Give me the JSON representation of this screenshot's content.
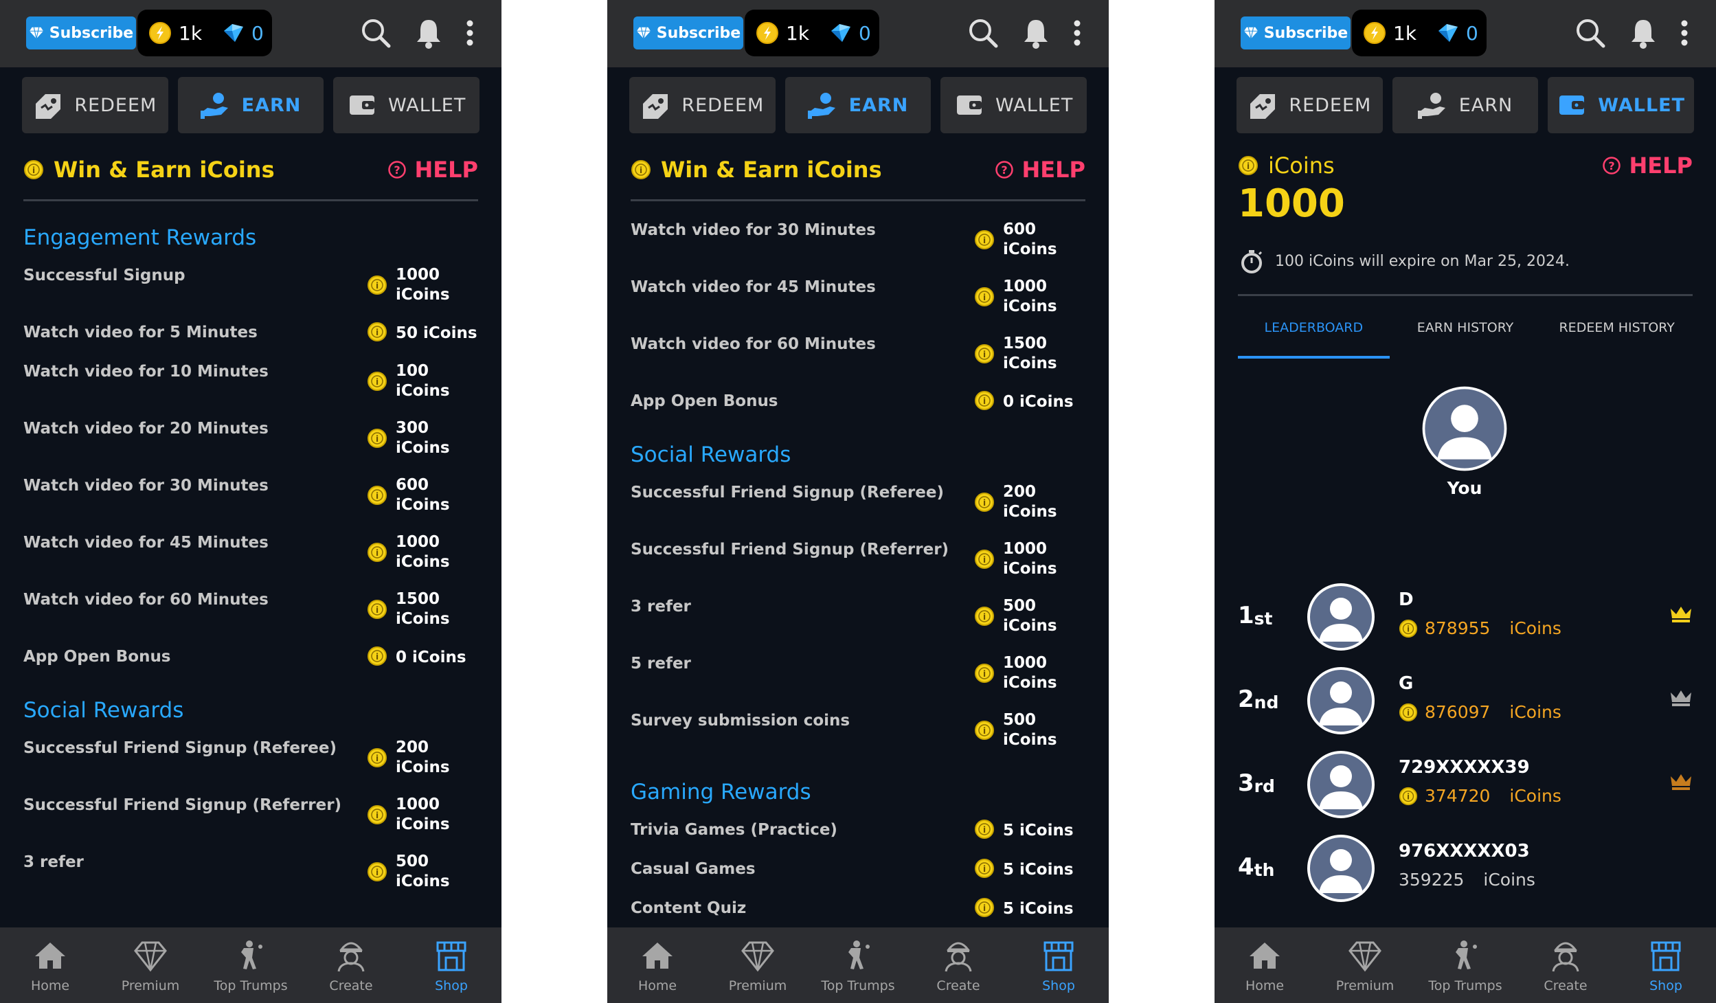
{
  "colors": {
    "background": "#0c111a",
    "topbar": "#2d2e30",
    "accent_blue": "#3aa3ff",
    "section_blue": "#29a9ff",
    "coin_yellow": "#f5d216",
    "help_red": "#ff3f6e",
    "score_orange": "#f5a623",
    "crown_gold": "#f2cf1b",
    "crown_silver": "#a7a7a7",
    "crown_bronze": "#c67c1e"
  },
  "topbar": {
    "subscribe_label": "Subscribe",
    "gold_coins": "1k",
    "diamonds": "0",
    "icons": [
      "diamond-icon",
      "coin-icon",
      "search-icon",
      "bell-icon",
      "more-vertical-icon"
    ]
  },
  "tabs": {
    "redeem": "REDEEM",
    "earn": "EARN",
    "wallet": "WALLET"
  },
  "earn": {
    "title": "Win & Earn iCoins",
    "help": "HELP"
  },
  "screen1": {
    "sections": [
      {
        "title": "Engagement Rewards",
        "rows": [
          {
            "label": "Successful Signup",
            "amount": "1000",
            "unit": "iCoins"
          },
          {
            "label": "Watch video for 5 Minutes",
            "amount": "50",
            "unit": "iCoins"
          },
          {
            "label": "Watch video for 10 Minutes",
            "amount": "100",
            "unit": "iCoins"
          },
          {
            "label": "Watch video for 20 Minutes",
            "amount": "300",
            "unit": "iCoins"
          },
          {
            "label": "Watch video for 30 Minutes",
            "amount": "600",
            "unit": "iCoins"
          },
          {
            "label": "Watch video for 45 Minutes",
            "amount": "1000",
            "unit": "iCoins"
          },
          {
            "label": "Watch video for 60 Minutes",
            "amount": "1500",
            "unit": "iCoins"
          },
          {
            "label": "App Open Bonus",
            "amount": "0",
            "unit": "iCoins"
          }
        ]
      },
      {
        "title": "Social Rewards",
        "rows": [
          {
            "label": "Successful Friend Signup (Referee)",
            "amount": "200",
            "unit": "iCoins"
          },
          {
            "label": "Successful Friend Signup (Referrer)",
            "amount": "1000",
            "unit": "iCoins"
          },
          {
            "label": "3 refer",
            "amount": "500",
            "unit": "iCoins"
          }
        ]
      }
    ]
  },
  "screen2": {
    "sections": [
      {
        "title": "",
        "rows": [
          {
            "label": "Watch video for 30 Minutes",
            "amount": "600",
            "unit": "iCoins"
          },
          {
            "label": "Watch video for 45 Minutes",
            "amount": "1000",
            "unit": "iCoins"
          },
          {
            "label": "Watch video for 60 Minutes",
            "amount": "1500",
            "unit": "iCoins"
          },
          {
            "label": "App Open Bonus",
            "amount": "0",
            "unit": "iCoins"
          }
        ]
      },
      {
        "title": "Social Rewards",
        "rows": [
          {
            "label": "Successful Friend Signup (Referee)",
            "amount": "200",
            "unit": "iCoins"
          },
          {
            "label": "Successful Friend Signup (Referrer)",
            "amount": "1000",
            "unit": "iCoins"
          },
          {
            "label": "3 refer",
            "amount": "500",
            "unit": "iCoins"
          },
          {
            "label": "5 refer",
            "amount": "1000",
            "unit": "iCoins"
          },
          {
            "label": "Survey submission coins",
            "amount": "500",
            "unit": "iCoins"
          }
        ]
      },
      {
        "title": "Gaming Rewards",
        "rows": [
          {
            "label": "Trivia Games (Practice)",
            "amount": "5",
            "unit": "iCoins"
          },
          {
            "label": "Casual Games",
            "amount": "5",
            "unit": "iCoins"
          },
          {
            "label": "Content Quiz",
            "amount": "5",
            "unit": "iCoins"
          }
        ]
      }
    ]
  },
  "wallet": {
    "title": "iCoins",
    "amount": "1000",
    "expire_text": "100 iCoins  will  expire on Mar 25, 2024.",
    "help": "HELP",
    "tabs": [
      "LEADERBOARD",
      "EARN HISTORY",
      "REDEEM HISTORY"
    ],
    "you_label": "You",
    "leaderboard": [
      {
        "rank": "1",
        "suffix": "st",
        "name": "D",
        "score": "878955",
        "unit": "iCoins",
        "crown": "gold"
      },
      {
        "rank": "2",
        "suffix": "nd",
        "name": "G",
        "score": "876097",
        "unit": "iCoins",
        "crown": "silver"
      },
      {
        "rank": "3",
        "suffix": "rd",
        "name": "729XXXXX39",
        "score": "374720",
        "unit": "iCoins",
        "crown": "bronze"
      },
      {
        "rank": "4",
        "suffix": "th",
        "name": "976XXXXX03",
        "score": "359225",
        "unit": "iCoins",
        "crown": ""
      }
    ]
  },
  "nav": {
    "items": [
      {
        "label": "Home",
        "icon": "home-icon"
      },
      {
        "label": "Premium",
        "icon": "diamond-icon"
      },
      {
        "label": "Top Trumps",
        "icon": "player-icon"
      },
      {
        "label": "Create",
        "icon": "avatar-icon"
      },
      {
        "label": "Shop",
        "icon": "shop-icon"
      }
    ],
    "active": "Shop"
  }
}
